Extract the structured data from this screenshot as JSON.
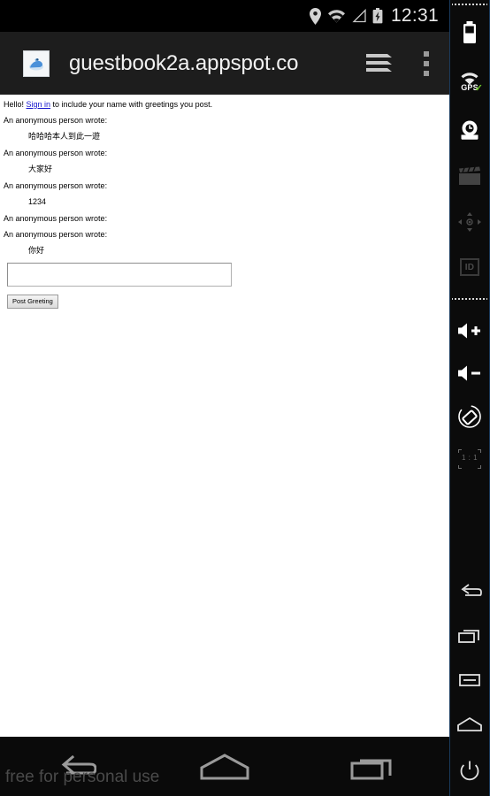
{
  "status_bar": {
    "time": "12:31",
    "icons": [
      "location-pin-icon",
      "wifi-icon",
      "cell-signal-icon",
      "battery-charging-icon"
    ]
  },
  "browser": {
    "url": "guestbook2a.appspot.co",
    "favicon_name": "site-favicon",
    "tabs_icon": "tabs-stack-icon",
    "menu_icon": "overflow-menu-icon"
  },
  "page": {
    "intro_before": "Hello! ",
    "signin_link": "Sign in",
    "intro_after": " to include your name with greetings you post.",
    "entries": [
      {
        "author": "An anonymous person wrote:",
        "message": "哈哈哈本人到此一遊"
      },
      {
        "author": "An anonymous person wrote:",
        "message": "大家好"
      },
      {
        "author": "An anonymous person wrote:",
        "message": "1234"
      },
      {
        "author": "An anonymous person wrote:",
        "message": ""
      },
      {
        "author": "An anonymous person wrote:",
        "message": "你好"
      }
    ],
    "form": {
      "input_value": "",
      "input_placeholder": "",
      "submit_label": "Post Greeting"
    }
  },
  "nav_bar": {
    "back": "back-button",
    "home": "home-button",
    "recents": "recents-button"
  },
  "watermark": "free for personal use",
  "side_panel": {
    "items": [
      {
        "name": "battery-icon",
        "label": ""
      },
      {
        "name": "gps-icon",
        "label": "GPS"
      },
      {
        "name": "camera-icon",
        "label": ""
      },
      {
        "name": "clapperboard-icon",
        "label": ""
      },
      {
        "name": "dpad-icon",
        "label": ""
      },
      {
        "name": "id-icon",
        "label": "ID"
      },
      {
        "name": "volume-up-icon",
        "label": ""
      },
      {
        "name": "volume-down-icon",
        "label": ""
      },
      {
        "name": "rotate-icon",
        "label": ""
      },
      {
        "name": "zoom-actual-size-icon",
        "label": "1 : 1"
      },
      {
        "name": "back-icon",
        "label": ""
      },
      {
        "name": "recents-icon",
        "label": ""
      },
      {
        "name": "menu-icon",
        "label": ""
      },
      {
        "name": "home-icon",
        "label": ""
      },
      {
        "name": "power-icon",
        "label": ""
      }
    ]
  },
  "colors": {
    "status_bar_bg": "#000000",
    "browser_bar_bg": "#1d1d1d",
    "page_bg": "#ffffff",
    "link": "#1111cc",
    "panel_bg": "#0b0b0b",
    "panel_border": "#1a3a5c",
    "gps_check": "#6ec82a"
  }
}
